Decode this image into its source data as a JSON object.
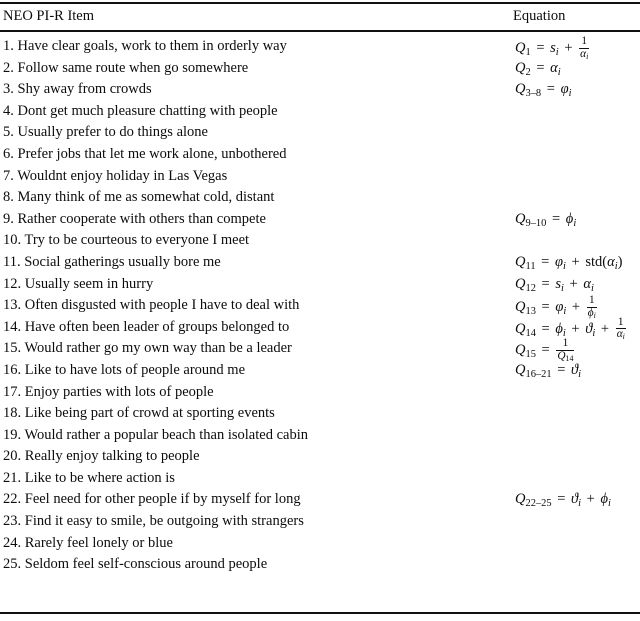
{
  "table": {
    "columns": {
      "item_header": "NEO PI-R Item",
      "equation_header": "Equation"
    },
    "rows": [
      {
        "n": 1,
        "item": "1. Have clear goals, work to them in orderly way",
        "equation_text": "Q_1 = s_i + 1/α_i"
      },
      {
        "n": 2,
        "item": "2. Follow same route when go somewhere",
        "equation_text": "Q_2 = α_i"
      },
      {
        "n": 3,
        "item": "3. Shy away from crowds",
        "equation_text": "Q_{3-8} = φ_i"
      },
      {
        "n": 4,
        "item": "4. Dont get much pleasure chatting with people",
        "equation_text": ""
      },
      {
        "n": 5,
        "item": "5. Usually prefer to do things alone",
        "equation_text": ""
      },
      {
        "n": 6,
        "item": "6. Prefer jobs that let me work alone, unbothered",
        "equation_text": ""
      },
      {
        "n": 7,
        "item": "7. Wouldnt enjoy holiday in Las Vegas",
        "equation_text": ""
      },
      {
        "n": 8,
        "item": "8. Many think of me as somewhat cold, distant",
        "equation_text": ""
      },
      {
        "n": 9,
        "item": "9. Rather cooperate with others than compete",
        "equation_text": "Q_{9-10} = ϕ_i"
      },
      {
        "n": 10,
        "item": "10. Try to be courteous to everyone I meet",
        "equation_text": ""
      },
      {
        "n": 11,
        "item": "11. Social gatherings usually bore me",
        "equation_text": "Q_{11} = φ_i + std(α_i)"
      },
      {
        "n": 12,
        "item": "12. Usually seem in hurry",
        "equation_text": "Q_{12} = s_i + α_i"
      },
      {
        "n": 13,
        "item": "13. Often disgusted with people I have to deal with",
        "equation_text": "Q_{13} = φ_i + 1/ϕ_i"
      },
      {
        "n": 14,
        "item": "14. Have often been leader of groups belonged to",
        "equation_text": "Q_{14} = ϕ_i + ϑ_i + 1/α_i"
      },
      {
        "n": 15,
        "item": "15. Would rather go my own way than be a leader",
        "equation_text": "Q_{15} = 1/Q_{14}"
      },
      {
        "n": 16,
        "item": "16. Like to have lots of people around me",
        "equation_text": "Q_{16-21} = ϑ_i"
      },
      {
        "n": 17,
        "item": "17. Enjoy parties with lots of people",
        "equation_text": ""
      },
      {
        "n": 18,
        "item": "18. Like being part of crowd at sporting events",
        "equation_text": ""
      },
      {
        "n": 19,
        "item": "19. Would rather a popular beach than isolated cabin",
        "equation_text": ""
      },
      {
        "n": 20,
        "item": "20. Really enjoy talking to people",
        "equation_text": ""
      },
      {
        "n": 21,
        "item": "21. Like to be where action is",
        "equation_text": ""
      },
      {
        "n": 22,
        "item": "22. Feel need for other people if by myself for long",
        "equation_text": "Q_{22-25} = ϑ_i + ϕ_i"
      },
      {
        "n": 23,
        "item": "23. Find it easy to smile, be outgoing with strangers",
        "equation_text": ""
      },
      {
        "n": 24,
        "item": "24. Rarely feel lonely or blue",
        "equation_text": ""
      },
      {
        "n": 25,
        "item": "25. Seldom feel self-conscious around people",
        "equation_text": ""
      }
    ],
    "equation_parts": {
      "1": [
        {
          "t": "v",
          "s": "Q"
        },
        {
          "t": "sub",
          "s": "1"
        },
        {
          "t": "op",
          "s": "="
        },
        {
          "t": "v",
          "s": "s"
        },
        {
          "t": "subi",
          "s": "i"
        },
        {
          "t": "op",
          "s": "+"
        },
        {
          "t": "frac",
          "num": "1",
          "den": "α",
          "deni": "i"
        }
      ],
      "2": [
        {
          "t": "v",
          "s": "Q"
        },
        {
          "t": "sub",
          "s": "2"
        },
        {
          "t": "op",
          "s": "="
        },
        {
          "t": "v",
          "s": "α"
        },
        {
          "t": "subi",
          "s": "i"
        }
      ],
      "3": [
        {
          "t": "v",
          "s": "Q"
        },
        {
          "t": "sub",
          "s": "3–8"
        },
        {
          "t": "op",
          "s": "="
        },
        {
          "t": "v",
          "s": "φ"
        },
        {
          "t": "subi",
          "s": "i"
        }
      ],
      "9": [
        {
          "t": "v",
          "s": "Q"
        },
        {
          "t": "sub",
          "s": "9–10"
        },
        {
          "t": "op",
          "s": "="
        },
        {
          "t": "v",
          "s": "ϕ"
        },
        {
          "t": "subi",
          "s": "i"
        }
      ],
      "11": [
        {
          "t": "v",
          "s": "Q"
        },
        {
          "t": "sub",
          "s": "11"
        },
        {
          "t": "op",
          "s": "="
        },
        {
          "t": "v",
          "s": "φ"
        },
        {
          "t": "subi",
          "s": "i"
        },
        {
          "t": "op",
          "s": "+"
        },
        {
          "t": "fn",
          "s": "std("
        },
        {
          "t": "v",
          "s": "α"
        },
        {
          "t": "subi",
          "s": "i"
        },
        {
          "t": "fn",
          "s": ")"
        }
      ],
      "12": [
        {
          "t": "v",
          "s": "Q"
        },
        {
          "t": "sub",
          "s": "12"
        },
        {
          "t": "op",
          "s": "="
        },
        {
          "t": "v",
          "s": "s"
        },
        {
          "t": "subi",
          "s": "i"
        },
        {
          "t": "op",
          "s": "+"
        },
        {
          "t": "v",
          "s": "α"
        },
        {
          "t": "subi",
          "s": "i"
        }
      ],
      "13": [
        {
          "t": "v",
          "s": "Q"
        },
        {
          "t": "sub",
          "s": "13"
        },
        {
          "t": "op",
          "s": "="
        },
        {
          "t": "v",
          "s": "φ"
        },
        {
          "t": "subi",
          "s": "i"
        },
        {
          "t": "op",
          "s": "+"
        },
        {
          "t": "frac",
          "num": "1",
          "den": "ϕ",
          "deni": "i"
        }
      ],
      "14": [
        {
          "t": "v",
          "s": "Q"
        },
        {
          "t": "sub",
          "s": "14"
        },
        {
          "t": "op",
          "s": "="
        },
        {
          "t": "v",
          "s": "ϕ"
        },
        {
          "t": "subi",
          "s": "i"
        },
        {
          "t": "op",
          "s": "+"
        },
        {
          "t": "v",
          "s": "ϑ"
        },
        {
          "t": "subi",
          "s": "i"
        },
        {
          "t": "op",
          "s": "+"
        },
        {
          "t": "frac",
          "num": "1",
          "den": "α",
          "deni": "i"
        }
      ],
      "15": [
        {
          "t": "v",
          "s": "Q"
        },
        {
          "t": "sub",
          "s": "15"
        },
        {
          "t": "op",
          "s": "="
        },
        {
          "t": "fracq",
          "num": "1",
          "den": "Q",
          "densub": "14"
        }
      ],
      "16": [
        {
          "t": "v",
          "s": "Q"
        },
        {
          "t": "sub",
          "s": "16–21"
        },
        {
          "t": "op",
          "s": "="
        },
        {
          "t": "v",
          "s": "ϑ"
        },
        {
          "t": "subi",
          "s": "i"
        }
      ],
      "22": [
        {
          "t": "v",
          "s": "Q"
        },
        {
          "t": "sub",
          "s": "22–25"
        },
        {
          "t": "op",
          "s": "="
        },
        {
          "t": "v",
          "s": "ϑ"
        },
        {
          "t": "subi",
          "s": "i"
        },
        {
          "t": "op",
          "s": "+"
        },
        {
          "t": "v",
          "s": "ϕ"
        },
        {
          "t": "subi",
          "s": "i"
        }
      ]
    }
  },
  "style": {
    "rule_color": "#111111",
    "text_color": "#0c0c0c",
    "background": "#ffffff"
  }
}
